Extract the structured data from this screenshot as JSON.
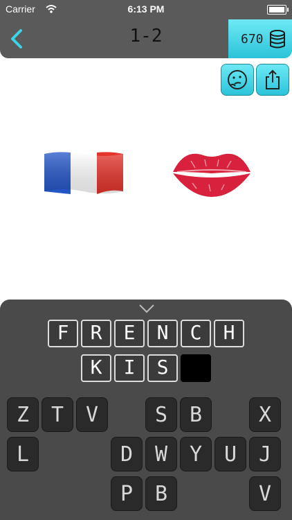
{
  "status_bar": {
    "carrier": "Carrier",
    "time": "6:13 PM"
  },
  "header": {
    "level": "1-2",
    "coins": "670",
    "back_icon": "chevron-left-icon",
    "coins_icon": "coin-stack-icon"
  },
  "helpers": [
    {
      "name": "hint",
      "icon": "thinking-face-icon"
    },
    {
      "name": "share",
      "icon": "share-icon"
    }
  ],
  "puzzle": {
    "emojis": [
      "french-flag-emoji",
      "kiss-lips-emoji"
    ]
  },
  "answer": {
    "row1": [
      "F",
      "R",
      "E",
      "N",
      "C",
      "H"
    ],
    "row2": [
      "K",
      "I",
      "S",
      ""
    ]
  },
  "keyboard": {
    "row1": [
      "Z",
      "T",
      "V",
      "S",
      "B",
      "X"
    ],
    "row2": [
      "L",
      "D",
      "W",
      "Y",
      "U",
      "J"
    ],
    "row3": [
      "P",
      "B",
      "V"
    ]
  },
  "colors": {
    "accent": "#3cd3e6",
    "bar": "#5a5a5a",
    "panel": "#4a4a4a"
  }
}
